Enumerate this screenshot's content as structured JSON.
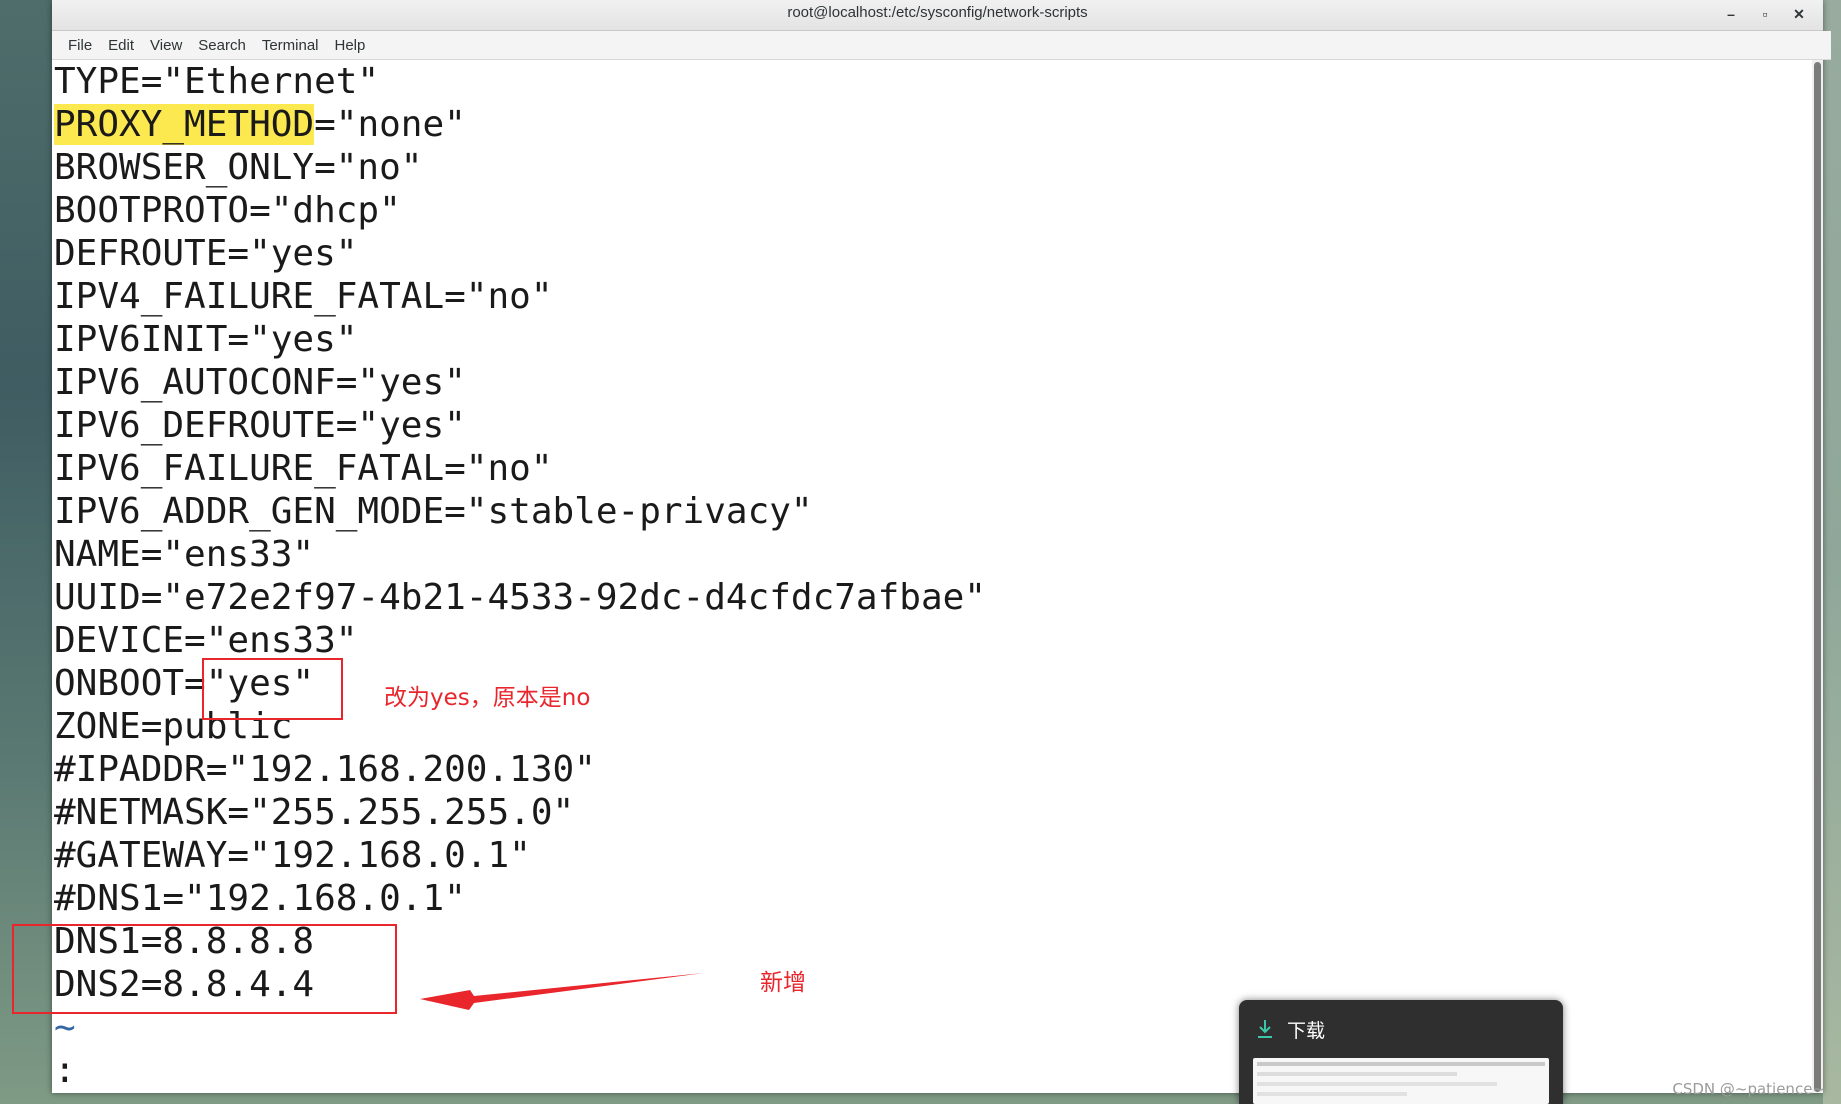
{
  "window": {
    "title": "root@localhost:/etc/sysconfig/network-scripts",
    "minimize_glyph": "–",
    "maximize_glyph": "▫",
    "close_glyph": "✕"
  },
  "menu": [
    "File",
    "Edit",
    "View",
    "Search",
    "Terminal",
    "Help"
  ],
  "terminal": {
    "lines": [
      "TYPE=\"Ethernet\"",
      "=\"none\"",
      "BROWSER_ONLY=\"no\"",
      "BOOTPROTO=\"dhcp\"",
      "DEFROUTE=\"yes\"",
      "IPV4_FAILURE_FATAL=\"no\"",
      "IPV6INIT=\"yes\"",
      "IPV6_AUTOCONF=\"yes\"",
      "IPV6_DEFROUTE=\"yes\"",
      "IPV6_FAILURE_FATAL=\"no\"",
      "IPV6_ADDR_GEN_MODE=\"stable-privacy\"",
      "NAME=\"ens33\"",
      "UUID=\"e72e2f97-4b21-4533-92dc-d4cfdc7afbae\"",
      "DEVICE=\"ens33\"",
      "ONBOOT=\"yes\"",
      "ZONE=public",
      "#IPADDR=\"192.168.200.130\"",
      "#NETMASK=\"255.255.255.0\"",
      "#GATEWAY=\"192.168.0.1\"",
      "#DNS1=\"192.168.0.1\"",
      "DNS1=8.8.8.8",
      "DNS2=8.8.4.4"
    ],
    "highlight_word": "PROXY_METHOD",
    "tilde": "~",
    "prompt": ":"
  },
  "annotations": {
    "onboot_note": "改为yes，原本是no",
    "added_note": "新增",
    "color": "#e8262c"
  },
  "download_popup": {
    "title": "下载",
    "icon": "download-icon"
  },
  "watermark": "CSDN @~patience~"
}
